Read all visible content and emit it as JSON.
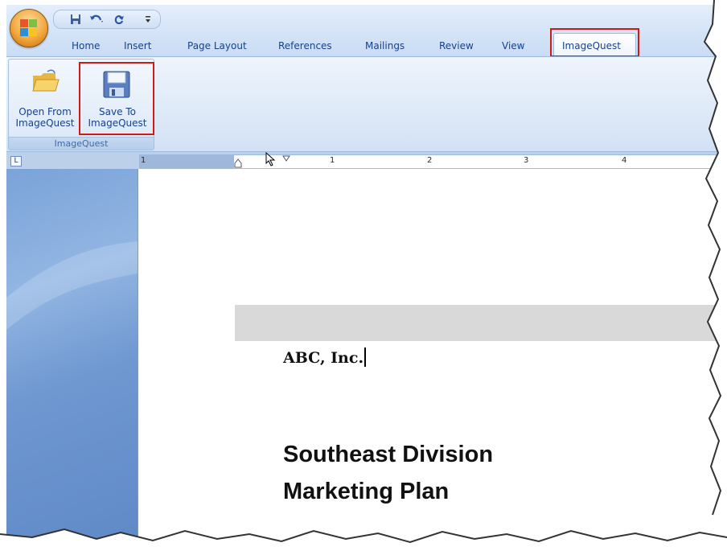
{
  "qat": {
    "save_icon": "save-icon",
    "undo_icon": "undo-icon",
    "redo_icon": "redo-icon",
    "customize_icon": "customize-qat-icon"
  },
  "tabs": [
    "Home",
    "Insert",
    "Page Layout",
    "References",
    "Mailings",
    "Review",
    "View",
    "ImageQuest"
  ],
  "active_tab": "ImageQuest",
  "ribbon": {
    "group_label": "ImageQuest",
    "buttons": [
      {
        "label_line1": "Open From",
        "label_line2": "ImageQuest",
        "icon": "folder-open-icon"
      },
      {
        "label_line1": "Save To",
        "label_line2": "ImageQuest",
        "icon": "floppy-save-icon"
      }
    ]
  },
  "ruler": {
    "numbers": [
      "1",
      "1",
      "2",
      "3",
      "4"
    ]
  },
  "document": {
    "line1": "ABC, Inc.",
    "heading_line1": "Southeast Division",
    "heading_line2": "Marketing Plan"
  },
  "colors": {
    "highlight_box": "#d01a1a",
    "ribbon_text": "#15428b"
  }
}
